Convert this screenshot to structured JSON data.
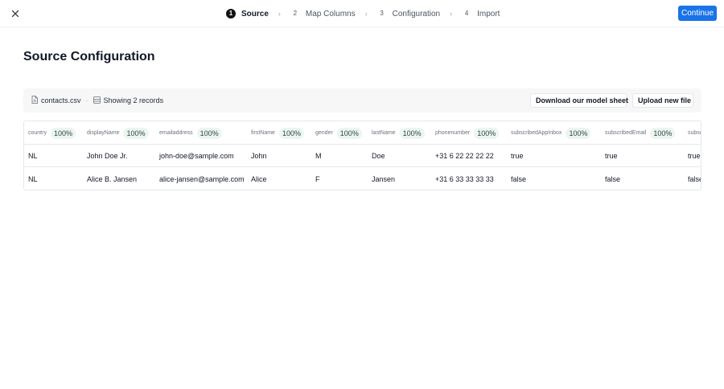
{
  "header": {
    "close_icon": "close-icon",
    "steps": [
      {
        "num": "1",
        "label": "Source",
        "active": true
      },
      {
        "num": "2",
        "label": "Map Columns",
        "active": false
      },
      {
        "num": "3",
        "label": "Configuration",
        "active": false
      },
      {
        "num": "4",
        "label": "Import",
        "active": false
      }
    ],
    "step_separator": "›",
    "continue_label": "Continue",
    "accent_color": "#1a73e8"
  },
  "page": {
    "title": "Source Configuration"
  },
  "info_bar": {
    "file_icon": "file-icon",
    "file_name": "contacts.csv",
    "separator": "·",
    "records_icon": "table-icon",
    "records_text": "Showing 2 records",
    "download_label": "Download our model sheet",
    "upload_label": "Upload new file"
  },
  "table": {
    "columns": [
      {
        "name": "country",
        "pct": "100%"
      },
      {
        "name": "displayName",
        "pct": "100%"
      },
      {
        "name": "emailaddress",
        "pct": "100%"
      },
      {
        "name": "firstName",
        "pct": "100%"
      },
      {
        "name": "gender",
        "pct": "100%"
      },
      {
        "name": "lastName",
        "pct": "100%"
      },
      {
        "name": "phonenumber",
        "pct": "100%"
      },
      {
        "name": "subscribedAppInbox",
        "pct": "100%"
      },
      {
        "name": "subscribedEmail",
        "pct": "100%"
      },
      {
        "name": "subsc",
        "pct": ""
      }
    ],
    "rows": [
      [
        "NL",
        "John Doe Jr.",
        "john-doe@sample.com",
        "John",
        "M",
        "Doe",
        "+31 6 22 22 22 22",
        "true",
        "true",
        "true"
      ],
      [
        "NL",
        "Alice B. Jansen",
        "alice-jansen@sample.com",
        "Alice",
        "F",
        "Jansen",
        "+31 6 33 33 33 33",
        "false",
        "false",
        "false"
      ]
    ]
  }
}
